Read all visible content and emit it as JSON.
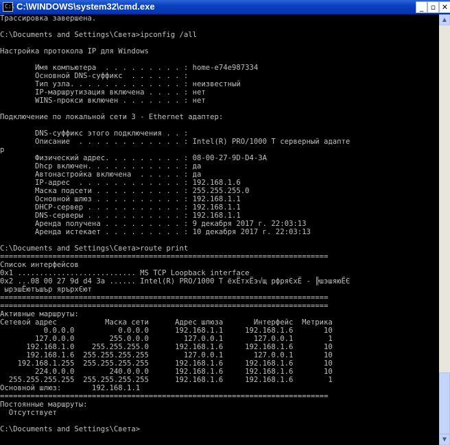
{
  "window": {
    "title": "C:\\WINDOWS\\system32\\cmd.exe",
    "icon": "cmd-icon",
    "buttons": {
      "minimize": "_",
      "maximize": "▫",
      "close": "✕"
    }
  },
  "console": {
    "lines": [
      "Трассировка завершена.",
      "",
      "C:\\Documents and Settings\\Света>ipconfig /all",
      "",
      "Настройка протокола IP для Windows",
      "",
      "        Имя компьютера  . . . . . . . . . : home-e74e987334",
      "        Основной DNS-суффикс  . . . . . . :",
      "        Тип узла. . . . . . . . . . . . . : неизвестный",
      "        IP-маршрутизация включена . . . . : нет",
      "        WINS-прокси включен . . . . . . . : нет",
      "",
      "Подключение по локальной сети 3 - Ethernet адаптер:",
      "",
      "        DNS-суффикс этого подключения . . :",
      "        Описание  . . . . . . . . . . . . : Intel(R) PRO/1000 T серверный адапте",
      "р",
      "        Физический адрес. . . . . . . . . : 08-00-27-9D-D4-3A",
      "        Dhcp включен. . . . . . . . . . . : да",
      "        Автонастройка включена  . . . . . : да",
      "        IP-адрес  . . . . . . . . . . . . : 192.168.1.6",
      "        Маска подсети . . . . . . . . . . : 255.255.255.0",
      "        Основной шлюз . . . . . . . . . . : 192.168.1.1",
      "        DHCP-сервер . . . . . . . . . . . : 192.168.1.1",
      "        DNS-серверы . . . . . . . . . . . : 192.168.1.1",
      "        Аренда получена . . . . . . . . . : 9 декабря 2017 г. 22:03:13",
      "        Аренда истекает . . . . . . . . . : 10 декабря 2017 г. 22:03:13",
      "",
      "C:\\Documents and Settings\\Света>route print",
      "===========================================================================",
      "Список интерфейсов",
      "0x1 ........................... MS TCP Loopback interface",
      "0x2 ...08 00 27 9d d4 3a ...... Intel(R) PRO/1000 T ёхЁтхЁэ√щ рфряЄхЁ - ╠шэшяюЁЄ",
      " ырэшЁютъшър ярърхЄют",
      "===========================================================================",
      "===========================================================================",
      "Активные маршруты:",
      "Сетевой адрес           Маска сети      Адрес шлюза       Интерфейс  Метрика",
      "          0.0.0.0          0.0.0.0      192.168.1.1     192.168.1.6       10",
      "        127.0.0.0        255.0.0.0        127.0.0.1       127.0.0.1        1",
      "      192.168.1.0    255.255.255.0      192.168.1.6     192.168.1.6       10",
      "      192.168.1.6  255.255.255.255        127.0.0.1       127.0.0.1       10",
      "    192.168.1.255  255.255.255.255      192.168.1.6     192.168.1.6       10",
      "        224.0.0.0        240.0.0.0      192.168.1.6     192.168.1.6       10",
      "  255.255.255.255  255.255.255.255      192.168.1.6     192.168.1.6        1",
      "Основной шлюз:       192.168.1.1",
      "===========================================================================",
      "Постоянные маршруты:",
      "  Отсутствует",
      "",
      "C:\\Documents and Settings\\Света>"
    ]
  },
  "scrollbar": {
    "up_arrow": "▲",
    "down_arrow": "▼"
  },
  "colors": {
    "titlebar": "#0a3fbf",
    "console_bg": "#000000",
    "console_text": "#c0c0c0"
  }
}
